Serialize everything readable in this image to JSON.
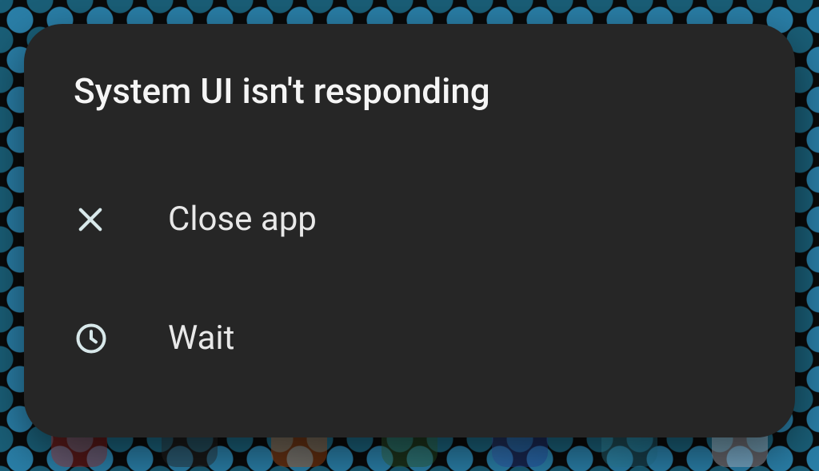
{
  "dialog": {
    "title": "System UI isn't responding",
    "options": [
      {
        "label": "Close app",
        "icon": "close"
      },
      {
        "label": "Wait",
        "icon": "clock"
      }
    ]
  }
}
